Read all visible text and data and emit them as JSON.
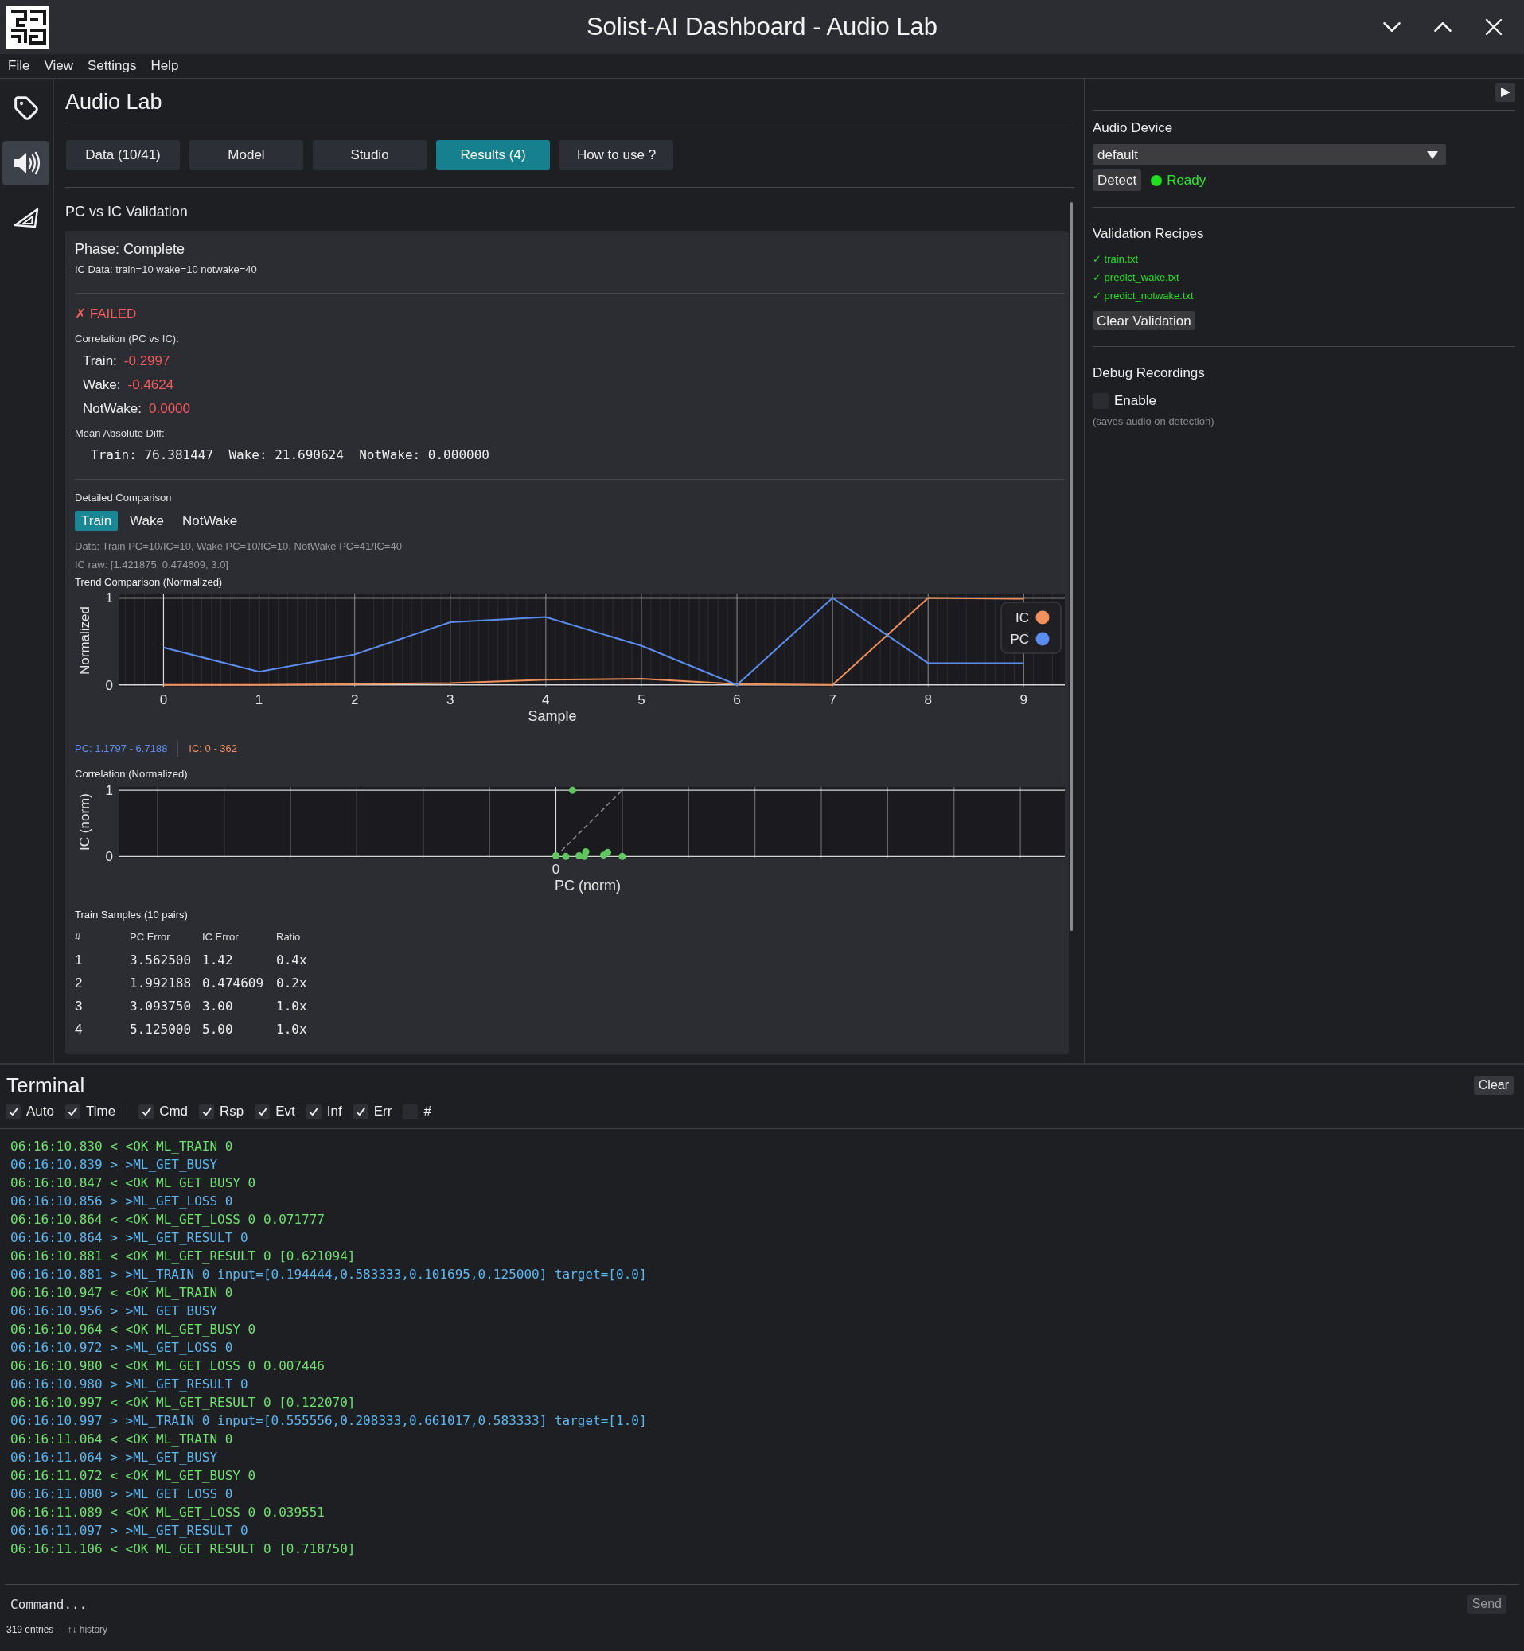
{
  "window": {
    "title": "Solist-AI Dashboard - Audio Lab"
  },
  "menu": [
    "File",
    "View",
    "Settings",
    "Help"
  ],
  "sidebar": {
    "items": [
      {
        "selected": false
      },
      {
        "selected": true
      },
      {
        "selected": false
      }
    ]
  },
  "page": {
    "title": "Audio Lab"
  },
  "tabs": [
    {
      "label": "Data (10/41)",
      "selected": false
    },
    {
      "label": "Model",
      "selected": false
    },
    {
      "label": "Studio",
      "selected": false
    },
    {
      "label": "Results (4)",
      "selected": true
    },
    {
      "label": "How to use ?",
      "selected": false
    }
  ],
  "validation": {
    "title": "PC vs IC Validation",
    "phase": "Phase: Complete",
    "ic_data": "IC Data: train=10 wake=10 notwake=40",
    "status": {
      "text": "✗ FAILED",
      "passed": false
    },
    "correlation_title": "Correlation (PC vs IC):",
    "correlations": [
      {
        "label": "Train:",
        "value": "-0.2997",
        "good": false
      },
      {
        "label": "Wake:",
        "value": "-0.4624",
        "good": false
      },
      {
        "label": "NotWake:",
        "value": "0.0000",
        "good": false
      }
    ],
    "mad_title": "Mean Absolute Diff:",
    "mad": "Train: 76.381447  Wake: 21.690624  NotWake: 0.000000"
  },
  "detail": {
    "title": "Detailed Comparison",
    "tabs": [
      {
        "label": "Train",
        "selected": true
      },
      {
        "label": "Wake",
        "selected": false
      },
      {
        "label": "NotWake",
        "selected": false
      }
    ],
    "data_info": "Data: Train PC=10/IC=10, Wake PC=10/IC=10, NotWake PC=41/IC=40",
    "ic_raw": "IC raw: [1.421875, 0.474609, 3.0]",
    "trend": {
      "title": "Trend Comparison (Normalized)",
      "chart_data": {
        "type": "line",
        "xlabel": "Sample",
        "ylabel": "Normalized",
        "x": [
          0,
          1,
          2,
          3,
          4,
          5,
          6,
          7,
          8,
          9
        ],
        "series": [
          {
            "name": "IC",
            "color": "#f0905a",
            "values": [
              0.0,
              0.0,
              0.01,
              0.02,
              0.06,
              0.07,
              0.01,
              0.0,
              1.0,
              0.99
            ]
          },
          {
            "name": "PC",
            "color": "#5b8def",
            "values": [
              0.43,
              0.15,
              0.35,
              0.72,
              0.78,
              0.45,
              0.0,
              1.0,
              0.25,
              0.25
            ]
          }
        ],
        "xlim": [
          -0.47,
          9.43
        ],
        "ylim": [
          -0.03,
          1.05
        ],
        "xticks": [
          0,
          1,
          2,
          3,
          4,
          5,
          6,
          7,
          8,
          9
        ],
        "yticks": [
          0,
          1
        ],
        "grid": true,
        "legend": true
      }
    },
    "ranges": [
      {
        "text": "PC: 1.1797 - 6.7188",
        "color": "#5b8def"
      },
      {
        "text": "IC: 0 - 362",
        "color": "#f0905a"
      }
    ],
    "correlation": {
      "title": "Correlation (Normalized)",
      "xlabel": "PC (norm)",
      "ylabel": "IC (norm)",
      "x_tick": "0",
      "y_ticks": [
        "1",
        "0"
      ]
    },
    "samples": {
      "title": "Train Samples (10 pairs)",
      "columns": [
        "#",
        "PC Error",
        "IC Error",
        "Ratio"
      ],
      "rows": [
        [
          "1",
          "3.562500",
          "1.42",
          "0.4x"
        ],
        [
          "2",
          "1.992188",
          "0.474609",
          "0.2x"
        ],
        [
          "3",
          "3.093750",
          "3.00",
          "1.0x"
        ],
        [
          "4",
          "5.125000",
          "5.00",
          "1.0x"
        ]
      ]
    }
  },
  "right_panel": {
    "audio_device": {
      "title": "Audio Device",
      "value": "default",
      "detect": "Detect",
      "status": "Ready",
      "ready": true
    },
    "recipes": {
      "title": "Validation Recipes",
      "items": [
        "✓ train.txt",
        "✓ predict_wake.txt",
        "✓ predict_notwake.txt"
      ],
      "clear": "Clear Validation"
    },
    "debug": {
      "title": "Debug Recordings",
      "enable": {
        "label": "Enable",
        "checked": false
      },
      "hint": "(saves audio on detection)"
    }
  },
  "terminal": {
    "title": "Terminal",
    "clear": "Clear",
    "toggles": [
      {
        "label": "Auto",
        "checked": true
      },
      {
        "label": "Time",
        "checked": true
      }
    ],
    "filters": [
      {
        "label": "Cmd",
        "checked": true
      },
      {
        "label": "Rsp",
        "checked": true
      },
      {
        "label": "Evt",
        "checked": true
      },
      {
        "label": "Inf",
        "checked": true
      },
      {
        "label": "Err",
        "checked": true
      },
      {
        "label": "#",
        "checked": false
      }
    ],
    "lines": [
      {
        "kind": "rsp",
        "text": "06:16:10.830 < <OK ML_TRAIN 0"
      },
      {
        "kind": "cmd",
        "text": "06:16:10.839 > >ML_GET_BUSY"
      },
      {
        "kind": "rsp",
        "text": "06:16:10.847 < <OK ML_GET_BUSY 0"
      },
      {
        "kind": "cmd",
        "text": "06:16:10.856 > >ML_GET_LOSS 0"
      },
      {
        "kind": "rsp",
        "text": "06:16:10.864 < <OK ML_GET_LOSS 0 0.071777"
      },
      {
        "kind": "cmd",
        "text": "06:16:10.864 > >ML_GET_RESULT 0"
      },
      {
        "kind": "rsp",
        "text": "06:16:10.881 < <OK ML_GET_RESULT 0 [0.621094]"
      },
      {
        "kind": "cmd",
        "text": "06:16:10.881 > >ML_TRAIN 0 input=[0.194444,0.583333,0.101695,0.125000] target=[0.0]"
      },
      {
        "kind": "rsp",
        "text": "06:16:10.947 < <OK ML_TRAIN 0"
      },
      {
        "kind": "cmd",
        "text": "06:16:10.956 > >ML_GET_BUSY"
      },
      {
        "kind": "rsp",
        "text": "06:16:10.964 < <OK ML_GET_BUSY 0"
      },
      {
        "kind": "cmd",
        "text": "06:16:10.972 > >ML_GET_LOSS 0"
      },
      {
        "kind": "rsp",
        "text": "06:16:10.980 < <OK ML_GET_LOSS 0 0.007446"
      },
      {
        "kind": "cmd",
        "text": "06:16:10.980 > >ML_GET_RESULT 0"
      },
      {
        "kind": "rsp",
        "text": "06:16:10.997 < <OK ML_GET_RESULT 0 [0.122070]"
      },
      {
        "kind": "cmd",
        "text": "06:16:10.997 > >ML_TRAIN 0 input=[0.555556,0.208333,0.661017,0.583333] target=[1.0]"
      },
      {
        "kind": "rsp",
        "text": "06:16:11.064 < <OK ML_TRAIN 0"
      },
      {
        "kind": "cmd",
        "text": "06:16:11.064 > >ML_GET_BUSY"
      },
      {
        "kind": "rsp",
        "text": "06:16:11.072 < <OK ML_GET_BUSY 0"
      },
      {
        "kind": "cmd",
        "text": "06:16:11.080 > >ML_GET_LOSS 0"
      },
      {
        "kind": "rsp",
        "text": "06:16:11.089 < <OK ML_GET_LOSS 0 0.039551"
      },
      {
        "kind": "cmd",
        "text": "06:16:11.097 > >ML_GET_RESULT 0"
      },
      {
        "kind": "rsp",
        "text": "06:16:11.106 < <OK ML_GET_RESULT 0 [0.718750]"
      }
    ],
    "command": {
      "placeholder": "Command..."
    },
    "send": "Send",
    "status": {
      "entries": "319 entries",
      "hint": "↑↓ history"
    }
  }
}
